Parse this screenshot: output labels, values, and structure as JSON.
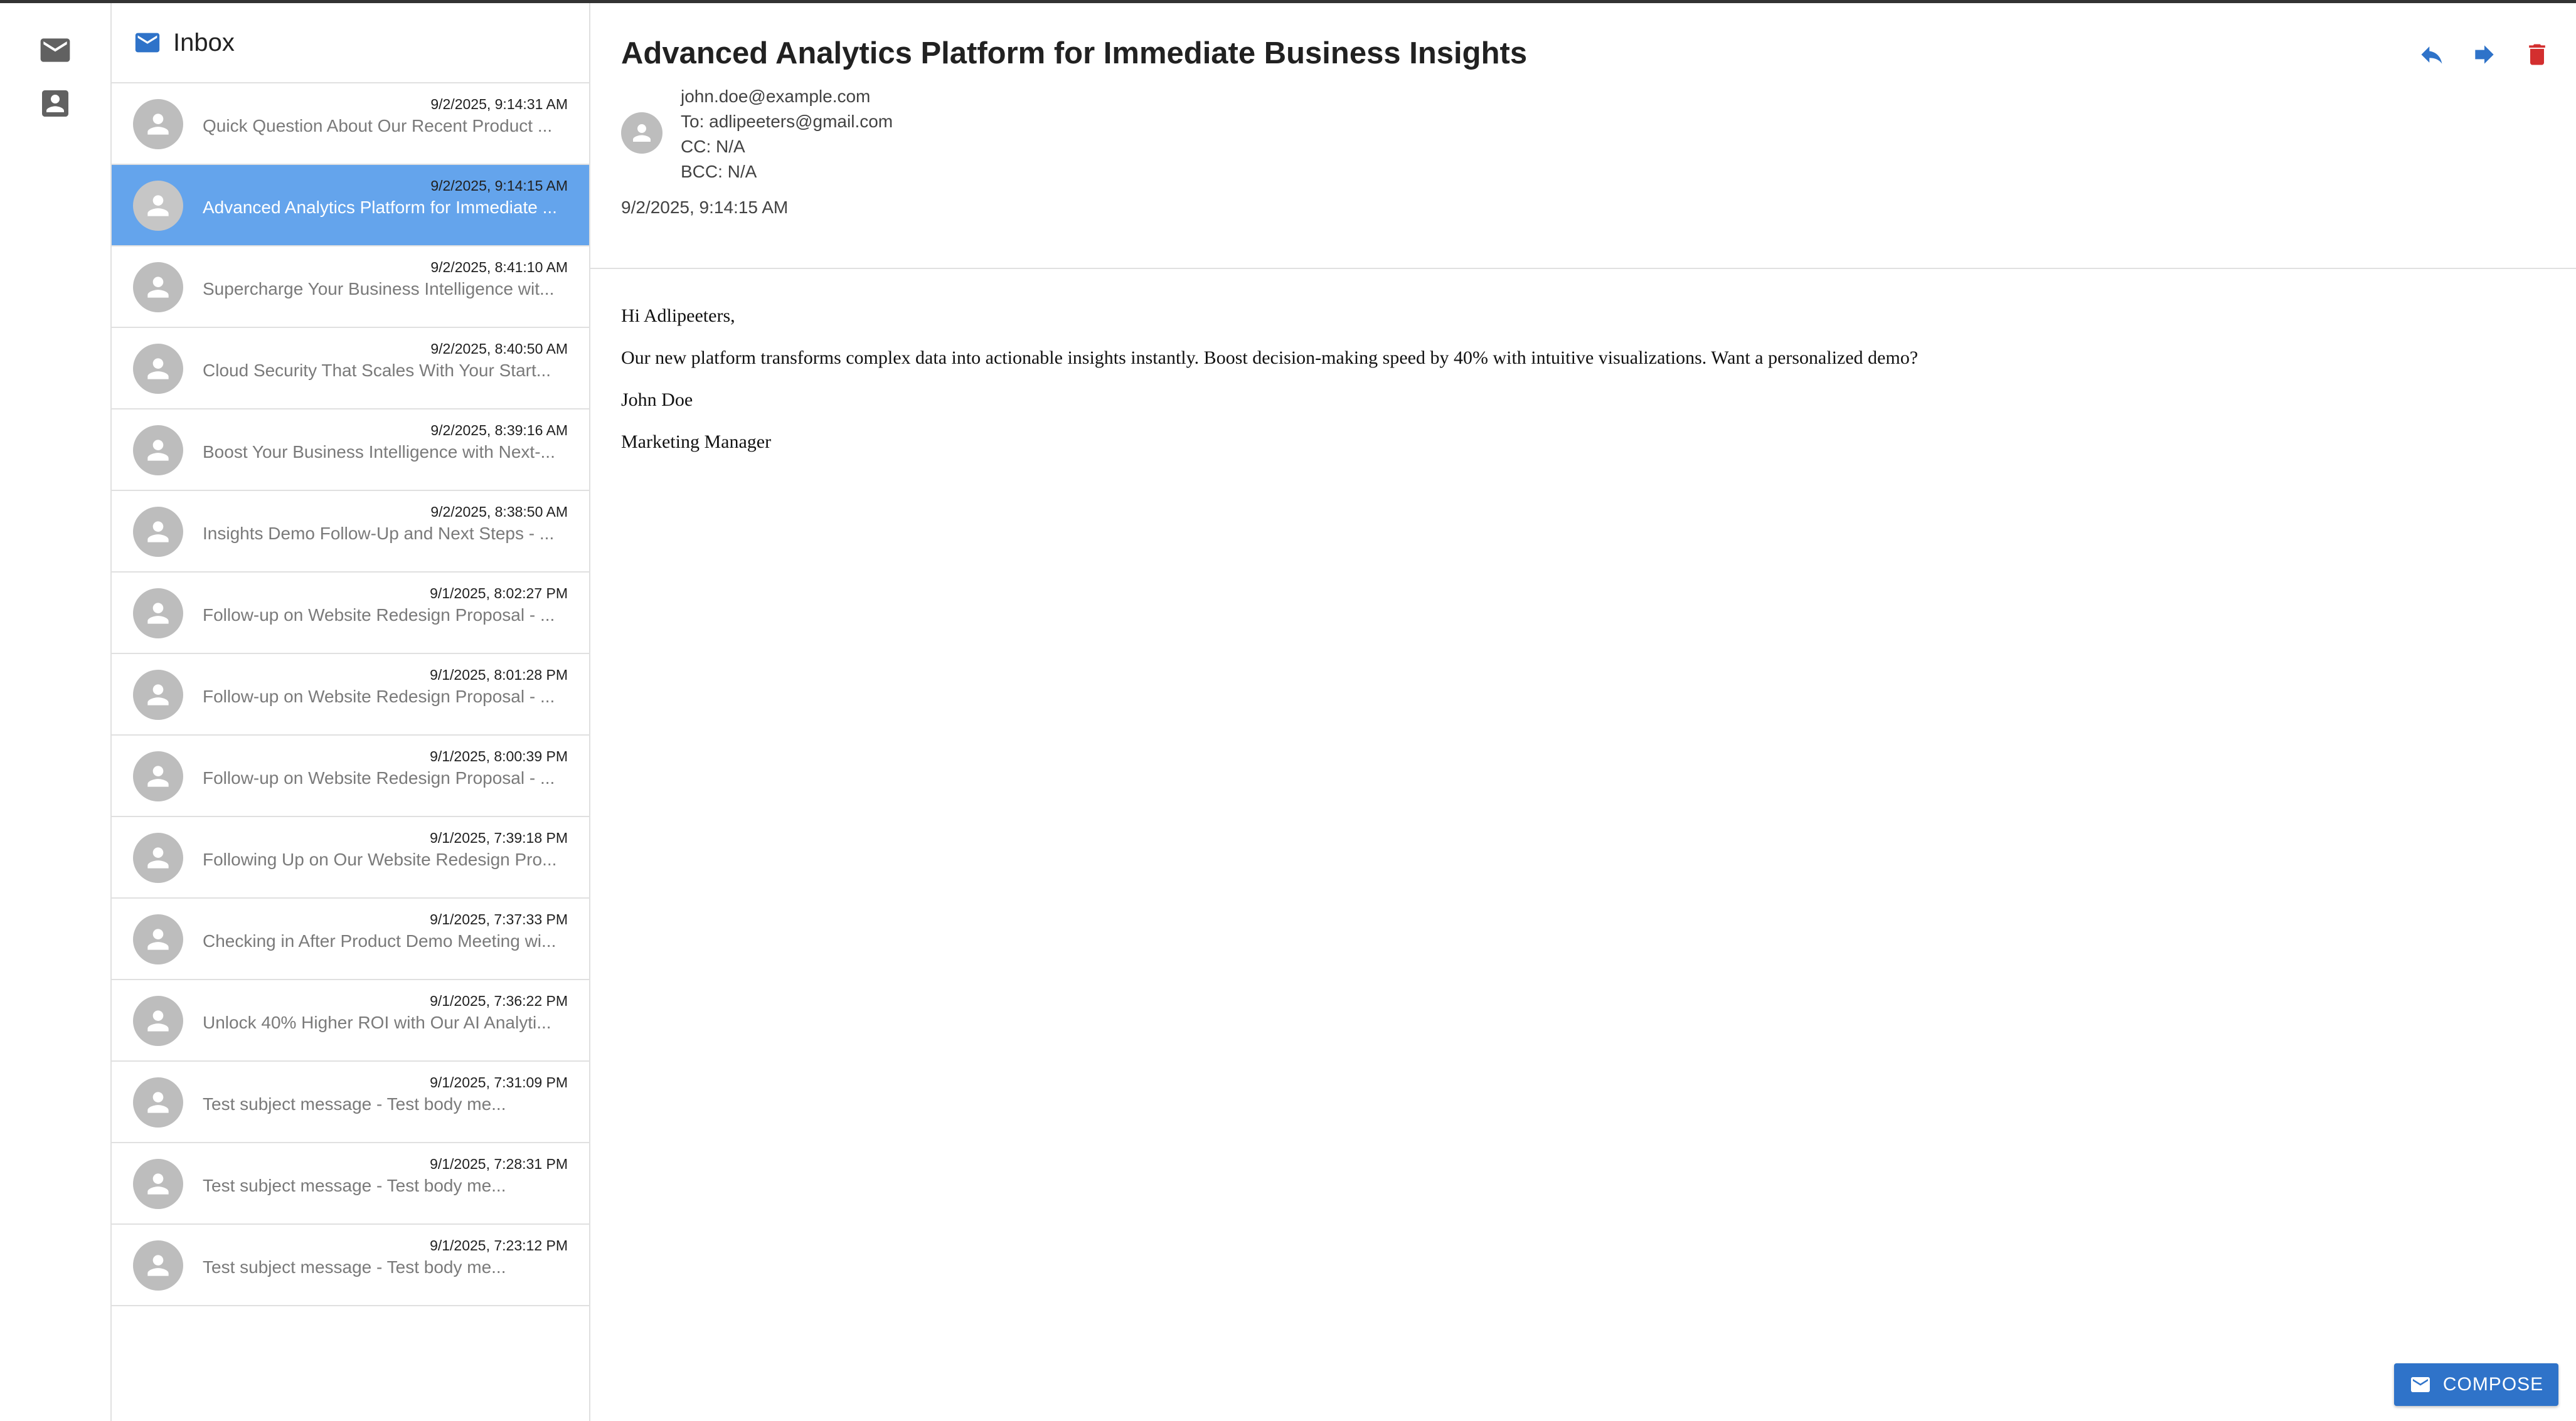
{
  "inbox": {
    "title": "Inbox",
    "messages": [
      {
        "timestamp": "9/2/2025, 9:14:31 AM",
        "subject": "Quick Question About Our Recent Product ...",
        "selected": false
      },
      {
        "timestamp": "9/2/2025, 9:14:15 AM",
        "subject": "Advanced Analytics Platform for Immediate ...",
        "selected": true
      },
      {
        "timestamp": "9/2/2025, 8:41:10 AM",
        "subject": "Supercharge Your Business Intelligence wit...",
        "selected": false
      },
      {
        "timestamp": "9/2/2025, 8:40:50 AM",
        "subject": "Cloud Security That Scales With Your Start...",
        "selected": false
      },
      {
        "timestamp": "9/2/2025, 8:39:16 AM",
        "subject": "Boost Your Business Intelligence with Next-...",
        "selected": false
      },
      {
        "timestamp": "9/2/2025, 8:38:50 AM",
        "subject": "Insights Demo Follow-Up and Next Steps - ...",
        "selected": false
      },
      {
        "timestamp": "9/1/2025, 8:02:27 PM",
        "subject": "Follow-up on Website Redesign Proposal - ...",
        "selected": false
      },
      {
        "timestamp": "9/1/2025, 8:01:28 PM",
        "subject": "Follow-up on Website Redesign Proposal - ...",
        "selected": false
      },
      {
        "timestamp": "9/1/2025, 8:00:39 PM",
        "subject": "Follow-up on Website Redesign Proposal - ...",
        "selected": false
      },
      {
        "timestamp": "9/1/2025, 7:39:18 PM",
        "subject": "Following Up on Our Website Redesign Pro...",
        "selected": false
      },
      {
        "timestamp": "9/1/2025, 7:37:33 PM",
        "subject": "Checking in After Product Demo Meeting wi...",
        "selected": false
      },
      {
        "timestamp": "9/1/2025, 7:36:22 PM",
        "subject": "Unlock 40% Higher ROI with Our AI Analyti...",
        "selected": false
      },
      {
        "timestamp": "9/1/2025, 7:31:09 PM",
        "subject": "Test subject message - Test body me...",
        "selected": false
      },
      {
        "timestamp": "9/1/2025, 7:28:31 PM",
        "subject": "Test subject message - Test body me...",
        "selected": false
      },
      {
        "timestamp": "9/1/2025, 7:23:12 PM",
        "subject": "Test subject message - Test body me...",
        "selected": false
      }
    ]
  },
  "message": {
    "title": "Advanced Analytics Platform for Immediate Business Insights",
    "from": "john.doe@example.com",
    "to": "To: adlipeeters@gmail.com",
    "cc": "CC: N/A",
    "bcc": "BCC: N/A",
    "date": "9/2/2025, 9:14:15 AM",
    "body": [
      "Hi Adlipeeters,",
      "Our new platform transforms complex data into actionable insights instantly. Boost decision-making speed by 40% with intuitive visualizations. Want a personalized demo?",
      "John Doe",
      "Marketing Manager"
    ]
  },
  "compose": {
    "label": "COMPOSE"
  },
  "icons": {
    "rail": [
      "mail-icon",
      "contact-icon"
    ],
    "actions": [
      "reply-icon",
      "forward-icon",
      "delete-icon"
    ]
  },
  "colors": {
    "accent": "#2f73c9",
    "selected_row": "#64a4ec",
    "delete": "#d32f2f",
    "rail_icon": "#616161"
  }
}
